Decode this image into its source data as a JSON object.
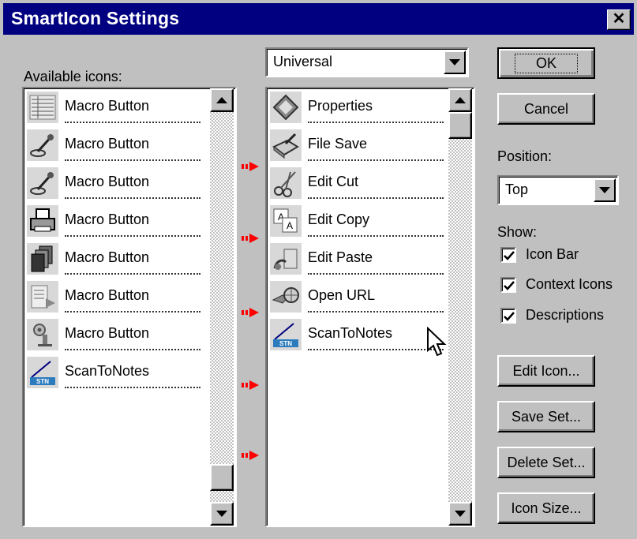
{
  "window": {
    "title": "SmartIcon Settings",
    "close_glyph": "✕"
  },
  "available": {
    "label": "Available icons:",
    "items": [
      {
        "icon": "macro-list-icon",
        "label": "Macro Button"
      },
      {
        "icon": "pen-icon",
        "label": "Macro Button"
      },
      {
        "icon": "pen-icon",
        "label": "Macro Button"
      },
      {
        "icon": "printer-icon",
        "label": "Macro Button"
      },
      {
        "icon": "pages-icon",
        "label": "Macro Button"
      },
      {
        "icon": "document-arrow-icon",
        "label": "Macro Button"
      },
      {
        "icon": "gear-person-icon",
        "label": "Macro Button"
      },
      {
        "icon": "scan-to-notes-icon",
        "label": "ScanToNotes"
      }
    ]
  },
  "set": {
    "selected": "Universal",
    "items": [
      {
        "icon": "properties-icon",
        "label": "Properties"
      },
      {
        "icon": "file-save-icon",
        "label": "File Save"
      },
      {
        "icon": "scissors-icon",
        "label": "Edit Cut"
      },
      {
        "icon": "edit-copy-icon",
        "label": "Edit Copy"
      },
      {
        "icon": "edit-paste-icon",
        "label": "Edit Paste"
      },
      {
        "icon": "open-url-icon",
        "label": "Open URL"
      },
      {
        "icon": "scan-to-notes-icon",
        "label": "ScanToNotes"
      }
    ]
  },
  "buttons": {
    "ok": "OK",
    "cancel": "Cancel",
    "edit_icon": "Edit Icon...",
    "save_set": "Save Set...",
    "delete_set": "Delete Set...",
    "icon_size": "Icon Size..."
  },
  "position": {
    "label": "Position:",
    "selected": "Top"
  },
  "show": {
    "label": "Show:",
    "icon_bar": {
      "label": "Icon Bar",
      "checked": true
    },
    "context_icons": {
      "label": "Context Icons",
      "checked": true
    },
    "descriptions": {
      "label": "Descriptions",
      "checked": true
    }
  },
  "colors": {
    "titlebar": "#000080",
    "face": "#c0c0c0",
    "arrow": "#ff0000"
  }
}
